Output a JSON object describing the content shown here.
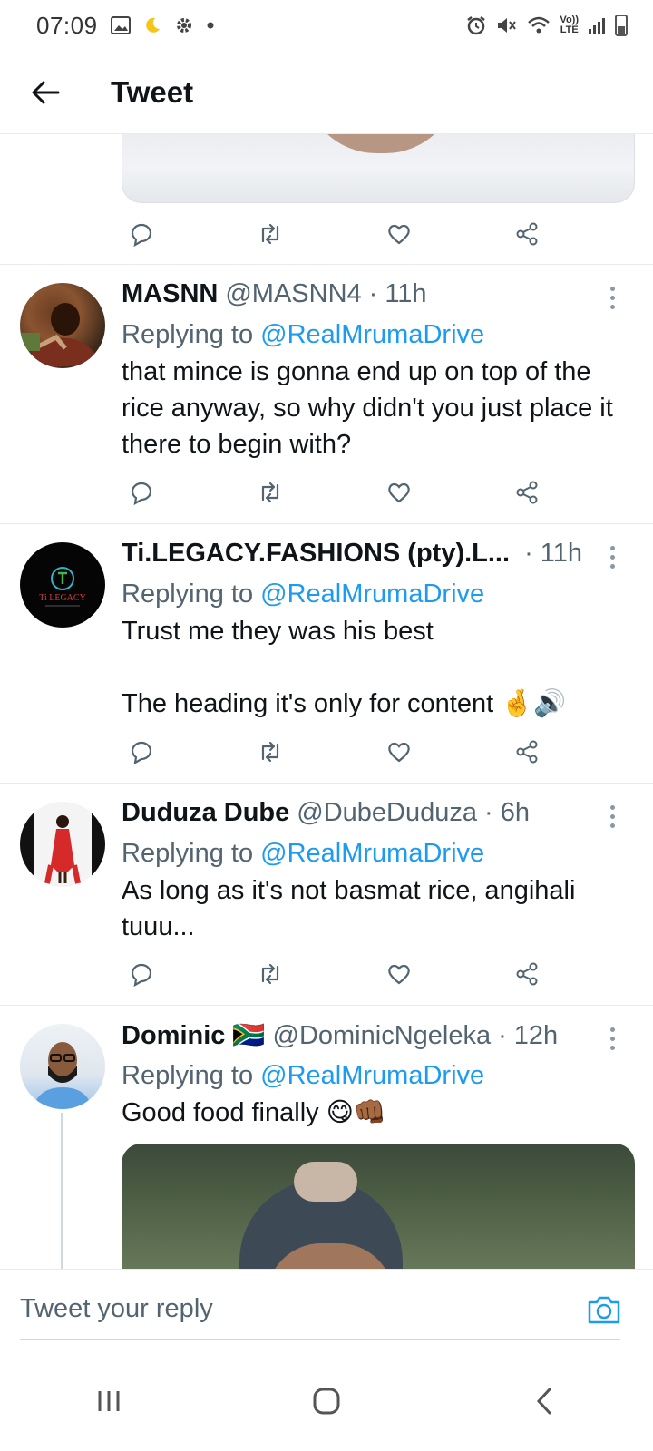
{
  "status_bar": {
    "time": "07:09",
    "left_icons": [
      "gallery-icon",
      "moon-icon",
      "gear-icon",
      "dot-icon"
    ],
    "right_icons": [
      "alarm-icon",
      "mute-icon",
      "wifi-icon",
      "volte-icon",
      "signal-icon",
      "battery-icon"
    ],
    "volte_label": "Vo))\nLTE"
  },
  "header": {
    "title": "Tweet"
  },
  "tweets": [
    {
      "display_name": "MASNN",
      "handle": "@MASNN4",
      "time": "11h",
      "replying_label": "Replying to",
      "replying_to": "@RealMrumaDrive",
      "text": "that mince is gonna end up on top of the rice anyway, so why didn't you just place it there to begin with?"
    },
    {
      "display_name": "Ti.LEGACY.FASHIONS (pty).L...",
      "handle": "",
      "time": "11h",
      "replying_label": "Replying to",
      "replying_to": "@RealMrumaDrive",
      "text": "Trust me they was his best\n\nThe heading it's only for content 🤞🔊"
    },
    {
      "display_name": "Duduza Dube",
      "handle": "@DubeDuduza",
      "time": "6h",
      "replying_label": "Replying to",
      "replying_to": "@RealMrumaDrive",
      "text": "As long as it's not basmat rice, angihali tuuu..."
    },
    {
      "display_name": "Dominic",
      "flag": "🇿🇦",
      "handle": "@DominicNgeleka",
      "time": "12h",
      "replying_label": "Replying to",
      "replying_to": "@RealMrumaDrive",
      "text": "Good food finally 😋👊🏾"
    }
  ],
  "legacy_avatar_text": "Ti LEGACY",
  "separator": "·",
  "reply_bar": {
    "placeholder": "Tweet your reply"
  },
  "colors": {
    "accent": "#1d9bf0",
    "secondary_text": "#536471",
    "divider": "#e6ecf0"
  }
}
